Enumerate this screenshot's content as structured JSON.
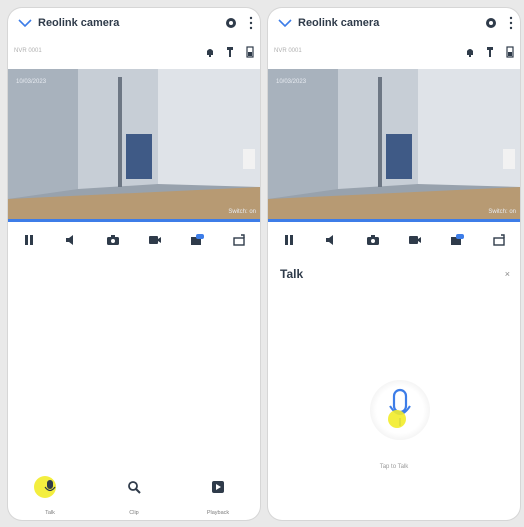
{
  "left": {
    "title": "Reolink camera",
    "subtitle": "NVR 0001",
    "stamp_left": "10/03/2023",
    "stamp_right": "Switch: on",
    "nav": [
      {
        "label": "Talk",
        "icon": "mic-icon"
      },
      {
        "label": "Clip",
        "icon": "search-icon"
      },
      {
        "label": "Playback",
        "icon": "play-icon"
      }
    ]
  },
  "right": {
    "title": "Reolink camera",
    "subtitle": "NVR 0001",
    "stamp_left": "10/03/2023",
    "stamp_right": "Switch: on",
    "talk_title": "Talk",
    "close": "×",
    "talk_hint": "Tap to Talk"
  },
  "colors": {
    "accent": "#3d7de8",
    "highlight": "#f2ec2a",
    "title": "#2f3b4a"
  }
}
